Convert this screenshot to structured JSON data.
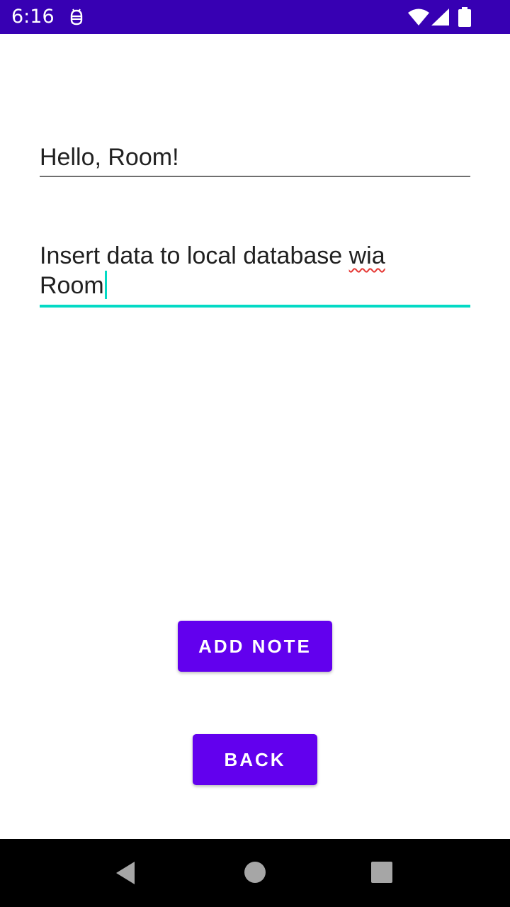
{
  "status_bar": {
    "time": "6:16",
    "app_icon": "android-debug-icon",
    "icons": [
      "wifi-icon",
      "cell-signal-icon",
      "battery-icon"
    ],
    "background_color": "#3700b3"
  },
  "form": {
    "title_value": "Hello, Room!",
    "description_value_part1": "Insert data to local database ",
    "description_misspelled_word": "wia",
    "description_value_part2": "Room",
    "focused_field": "description",
    "accent_color": "#03dac5"
  },
  "buttons": {
    "add_note_label": "ADD NOTE",
    "back_label": "BACK",
    "color": "#6200ee"
  },
  "nav_bar": {
    "icons": [
      "nav-back-icon",
      "nav-home-icon",
      "nav-recents-icon"
    ]
  }
}
